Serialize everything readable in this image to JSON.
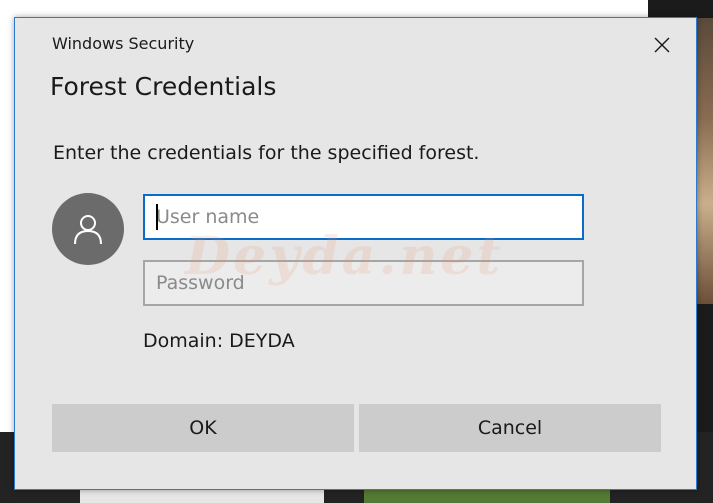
{
  "dialog": {
    "app_title": "Windows Security",
    "heading": "Forest Credentials",
    "instruction": "Enter the credentials for the specified forest.",
    "username": {
      "placeholder": "User name",
      "value": ""
    },
    "password": {
      "placeholder": "Password",
      "value": ""
    },
    "domain_text": "Domain: DEYDA",
    "ok_label": "OK",
    "cancel_label": "Cancel",
    "watermark": "Deyda.net"
  },
  "icons": {
    "close": "close-icon",
    "avatar": "user-icon"
  },
  "colors": {
    "dialog_background": "#e6e6e6",
    "dialog_border": "#2b7bd1",
    "focus_border": "#0a6cc9",
    "button_background": "#cccccc",
    "avatar_background": "#6b6b6b"
  }
}
